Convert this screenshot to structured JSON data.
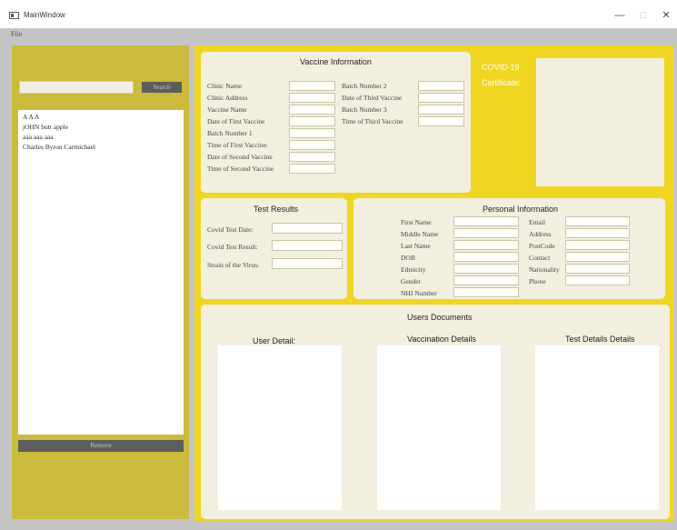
{
  "window": {
    "title": "MainWindow",
    "minimize": "—",
    "maximize": "□",
    "close": "✕"
  },
  "menu": {
    "file": "File"
  },
  "sidebar": {
    "search_value": "",
    "search_button": "Search",
    "users": [
      "A A A",
      "jOHN butt apple",
      "aaa aaa aaa",
      "Charles  Byron Carmichael"
    ],
    "remove_button": "Remove"
  },
  "vaccine": {
    "title": "Vaccine Information",
    "left_fields": [
      "Clinic Name",
      "Clinic Address",
      "Vaccine Name",
      "Date of First Vaccine",
      "Batch Number 1",
      "Time of First Vaccine:",
      "Date of Second Vaccine",
      "Time of Second Vaccine"
    ],
    "right_fields": [
      "Batch Number 2",
      "Date of Third Vaccine",
      "Batch Number 3",
      "Time of Third Vaccine"
    ]
  },
  "certificate": {
    "line1": "COVID-19",
    "line2": "Certificate:"
  },
  "test_results": {
    "title": "Test Results",
    "fields": [
      "Covid Test Date:",
      "Covid Test Result:",
      "Strain of the Virus:"
    ]
  },
  "personal": {
    "title": "Personal Information",
    "left_fields": [
      "First Name",
      "Middle Name",
      "Last Name",
      "DOB",
      "Ethnicity",
      "Gender",
      "NHI Number"
    ],
    "right_fields": [
      "Email",
      "Address",
      "PostCode",
      "Contact",
      "Nationality",
      "Phone"
    ]
  },
  "documents": {
    "title": "Users Documents",
    "columns": [
      "User Detail:",
      "Vaccination Details",
      "Test Details Details"
    ]
  },
  "colors": {
    "sidebar_bg": "#cbba3c",
    "main_bg": "#f0d620",
    "card_bg": "#f2efdf",
    "button_bg": "#5d5d5d"
  }
}
